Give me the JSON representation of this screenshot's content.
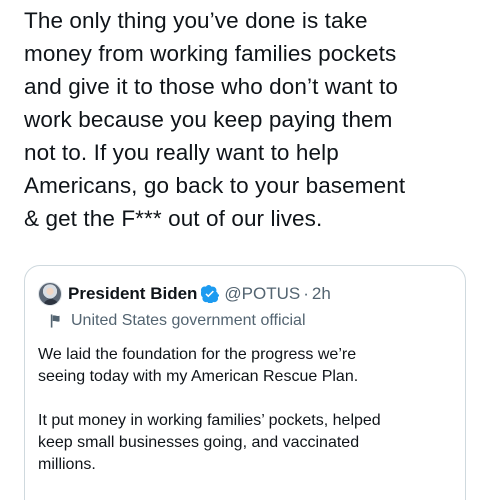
{
  "tweet": {
    "text_lines": [
      "The only thing you’ve done is take",
      "money from working families pockets",
      "and give it to those who don’t want to",
      "work because you keep paying them",
      "not to. If you really want to help",
      "Americans, go back to your basement",
      "& get the F*** out of our lives."
    ]
  },
  "quoted_tweet": {
    "author_name": "President Biden",
    "handle": "@POTUS",
    "separator": "·",
    "timestamp": "2h",
    "official_label": "United States government official",
    "body_lines": [
      "We laid the foundation for the progress we’re",
      "seeing today with my American Rescue Plan.",
      "",
      "It put money in working families’ pockets, helped",
      "keep small businesses going, and vaccinated",
      "millions."
    ]
  },
  "icons": {
    "verified": "verified-icon",
    "official": "flag-icon",
    "avatar": "avatar"
  },
  "colors": {
    "text": "#0f1419",
    "secondary_text": "#536471",
    "border": "#cfd9de",
    "verified": "#1d9bf0"
  }
}
